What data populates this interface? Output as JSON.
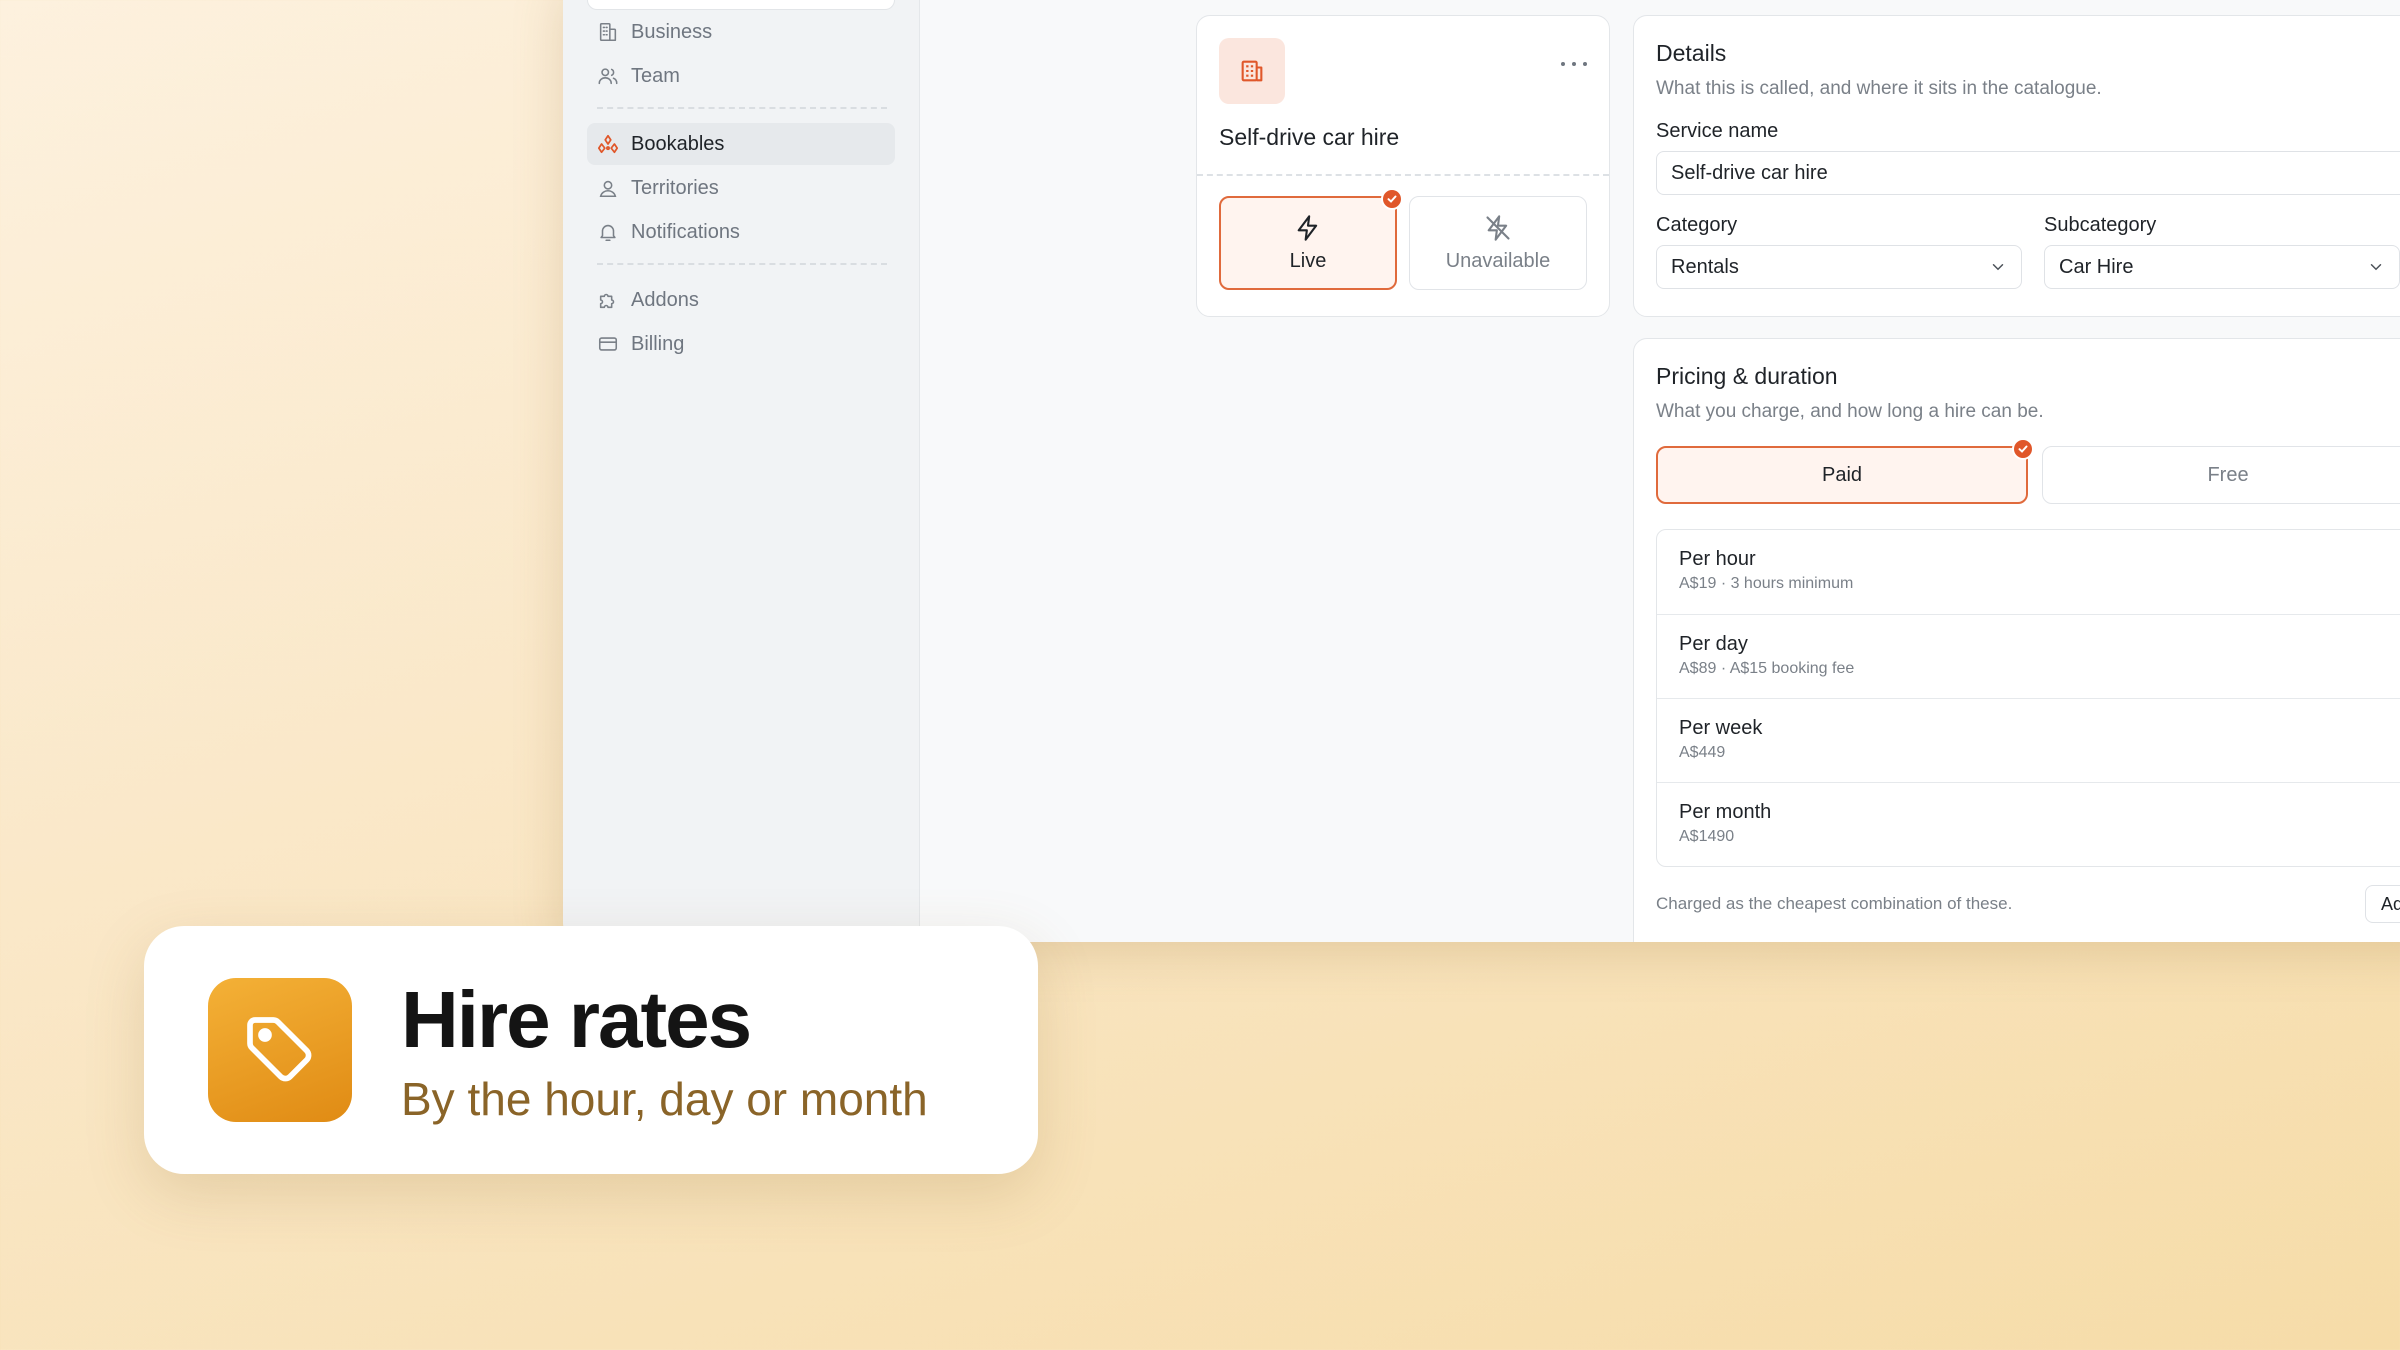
{
  "sidebar": {
    "items": [
      {
        "label": "Business",
        "icon": "building-icon"
      },
      {
        "label": "Team",
        "icon": "users-icon"
      },
      {
        "label": "Bookables",
        "icon": "bookables-icon",
        "active": true
      },
      {
        "label": "Territories",
        "icon": "map-pin-user-icon"
      },
      {
        "label": "Notifications",
        "icon": "bell-icon"
      },
      {
        "label": "Addons",
        "icon": "puzzle-icon"
      },
      {
        "label": "Billing",
        "icon": "credit-card-icon"
      }
    ]
  },
  "service_card": {
    "name": "Self-drive car hire",
    "status_options": [
      {
        "label": "Live",
        "selected": true
      },
      {
        "label": "Unavailable",
        "selected": false
      }
    ]
  },
  "details": {
    "title": "Details",
    "subtitle": "What this is called, and where it sits in the catalogue.",
    "service_name_label": "Service name",
    "service_name_value": "Self-drive car hire",
    "category_label": "Category",
    "category_value": "Rentals",
    "subcategory_label": "Subcategory",
    "subcategory_value": "Car Hire"
  },
  "pricing": {
    "title": "Pricing & duration",
    "subtitle": "What you charge, and how long a hire can be.",
    "mode_options": [
      {
        "label": "Paid",
        "selected": true
      },
      {
        "label": "Free",
        "selected": false
      }
    ],
    "rates": [
      {
        "title": "Per hour",
        "detail": "A$19 · 3 hours minimum"
      },
      {
        "title": "Per day",
        "detail": "A$89 · A$15 booking fee"
      },
      {
        "title": "Per week",
        "detail": "A$449"
      },
      {
        "title": "Per month",
        "detail": "A$1490"
      }
    ],
    "footnote": "Charged as the cheapest combination of these.",
    "add_price_label": "Add Price"
  },
  "overlay": {
    "title": "Hire rates",
    "subtitle": "By the hour, day or month"
  },
  "colors": {
    "accent": "#e0572a",
    "overlay_icon": "#e8971f",
    "overlay_subtitle": "#8a6428"
  }
}
